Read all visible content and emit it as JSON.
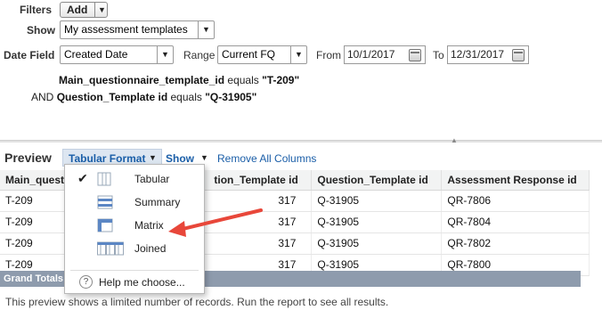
{
  "filters": {
    "filters_label": "Filters",
    "add_label": "Add",
    "show_label": "Show",
    "show_value": "My assessment templates",
    "date_field_label": "Date Field",
    "date_field_value": "Created Date",
    "range_label": "Range",
    "range_value": "Current FQ",
    "from_label": "From",
    "from_value": "10/1/2017",
    "to_label": "To",
    "to_value": "12/31/2017",
    "criteria": [
      {
        "prefix": "",
        "field": "Main_questionnaire_template_id",
        "op": "equals",
        "value": "\"T-209\""
      },
      {
        "prefix": "AND",
        "field": "Question_Template id",
        "op": "equals",
        "value": "\"Q-31905\""
      }
    ]
  },
  "preview": {
    "title": "Preview",
    "format_button": "Tabular Format",
    "show_button": "Show",
    "remove_all": "Remove All Columns"
  },
  "table": {
    "headers": [
      "Main_questi",
      "tion_Template id",
      "Question_Template id",
      "Assessment Response id"
    ],
    "rows": [
      [
        "T-209",
        "317",
        "Q-31905",
        "QR-7806"
      ],
      [
        "T-209",
        "317",
        "Q-31905",
        "QR-7804"
      ],
      [
        "T-209",
        "317",
        "Q-31905",
        "QR-7802"
      ],
      [
        "T-209",
        "317",
        "Q-31905",
        "QR-7800"
      ]
    ],
    "grand_totals": "Grand Totals"
  },
  "footnote": "This preview shows a limited number of records. Run the report to see all results.",
  "format_menu": {
    "items": [
      {
        "label": "Tabular",
        "icon": "tabular-format-icon",
        "checked": true
      },
      {
        "label": "Summary",
        "icon": "summary-format-icon",
        "checked": false
      },
      {
        "label": "Matrix",
        "icon": "matrix-format-icon",
        "checked": false
      },
      {
        "label": "Joined",
        "icon": "joined-format-icon",
        "checked": false
      }
    ],
    "help": "Help me choose..."
  },
  "annotation": {
    "arrow_color": "#e8473a"
  }
}
